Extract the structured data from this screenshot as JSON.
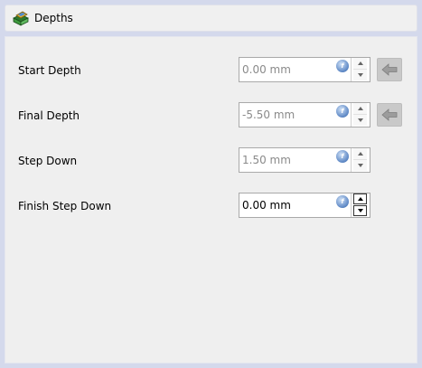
{
  "header": {
    "title": "Depths",
    "icon": "cube-layers-icon"
  },
  "fields": [
    {
      "label": "Start Depth",
      "value": "0.00 mm",
      "enabled": false,
      "has_reset": true
    },
    {
      "label": "Final Depth",
      "value": "-5.50 mm",
      "enabled": false,
      "has_reset": true
    },
    {
      "label": "Step Down",
      "value": "1.50 mm",
      "enabled": false,
      "has_reset": false
    },
    {
      "label": "Finish Step Down",
      "value": "0.00 mm",
      "enabled": true,
      "has_reset": false
    }
  ],
  "colors": {
    "background": "#d4d9ec",
    "panel": "#efefef",
    "disabled_text": "#8a8a8a"
  }
}
